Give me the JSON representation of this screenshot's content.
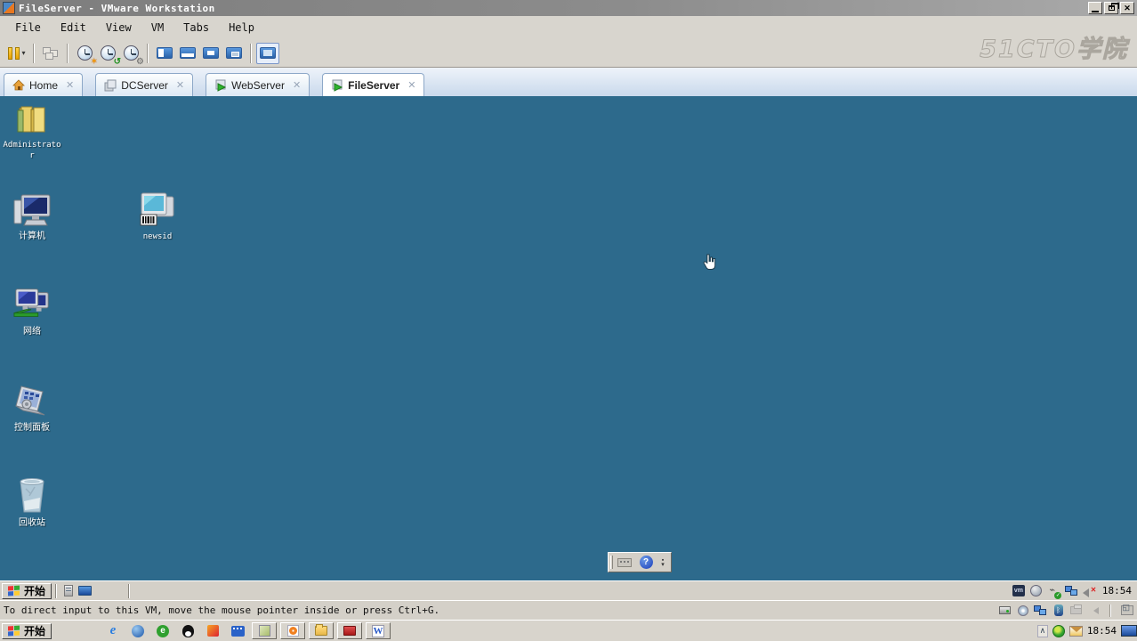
{
  "window": {
    "title": "FileServer - VMware Workstation"
  },
  "menu": {
    "items": [
      "File",
      "Edit",
      "View",
      "VM",
      "Tabs",
      "Help"
    ]
  },
  "watermark": {
    "text": "51CTO学院"
  },
  "toolbar": {
    "icons": [
      "suspend-power",
      "send-ctrl-alt-del",
      "take-snapshot",
      "revert-snapshot",
      "manage-snapshots",
      "show-sidebar-view",
      "show-thumbnail-view",
      "fullscreen-view",
      "unity-view",
      "console-view-active"
    ]
  },
  "tabs": {
    "items": [
      {
        "label": "Home",
        "icon": "home",
        "active": false
      },
      {
        "label": "DCServer",
        "icon": "vm-powered-off",
        "active": false
      },
      {
        "label": "WebServer",
        "icon": "vm-running",
        "active": false
      },
      {
        "label": "FileServer",
        "icon": "vm-running",
        "active": true
      }
    ]
  },
  "desktop": {
    "background_color": "#2d6a8c",
    "icons": [
      {
        "label": "Administrator",
        "icon": "user-folders"
      },
      {
        "label": "计算机",
        "icon": "computer"
      },
      {
        "label": "newsid",
        "icon": "newsid-app"
      },
      {
        "label": "网络",
        "icon": "network"
      },
      {
        "label": "控制面板",
        "icon": "control-panel"
      },
      {
        "label": "回收站",
        "icon": "recycle-bin"
      }
    ],
    "cursor": "hand-pointer"
  },
  "language_bar": {
    "icons": [
      "keyboard",
      "help",
      "options-chevron"
    ]
  },
  "vm_taskbar": {
    "start_label": "开始",
    "quick_launch": [
      "server-manager",
      "show-desktop"
    ],
    "tray_icons": [
      "vmware-tools",
      "scheduled-task",
      "safely-remove-hardware",
      "network",
      "volume-muted"
    ],
    "clock": "18:54"
  },
  "status_bar": {
    "message": "To direct input to this VM, move the mouse pointer inside or press Ctrl+G.",
    "device_icons": [
      "hard-disk",
      "cd-dvd",
      "network-adapter",
      "bluetooth",
      "printer",
      "sound"
    ],
    "corner_icon": "exit-fullscreen"
  },
  "host_taskbar": {
    "start_label": "开始",
    "quick_launch": [
      "internet-explorer",
      "browser-globe",
      "green-browser",
      "qq",
      "media-box",
      "video-player"
    ],
    "task_buttons": [
      "notepad",
      "office-o",
      "folder",
      "toolbox",
      "word"
    ],
    "tray": {
      "chevron": "hide-inactive-icons",
      "icons": [
        "antivirus",
        "mail-guard"
      ],
      "clock": "18:54",
      "edge_icon": "display"
    }
  }
}
